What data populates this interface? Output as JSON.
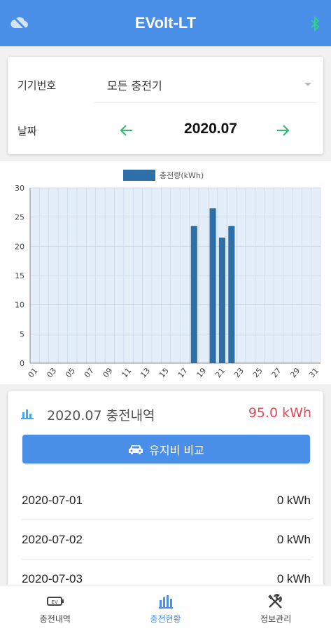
{
  "app": {
    "title": "EVolt-LT"
  },
  "filter": {
    "device_label": "기기번호",
    "device_value": "모든 충전기",
    "date_label": "날짜",
    "date_value": "2020.07"
  },
  "chart_data": {
    "type": "bar",
    "legend": [
      "충전량(kWh)"
    ],
    "series": [
      {
        "name": "충전량(kWh)",
        "color": "#2e6fa8",
        "values": [
          0,
          0,
          0,
          0,
          0,
          0,
          0,
          0,
          0,
          0,
          0,
          0,
          0,
          0,
          0,
          0,
          0,
          23.5,
          0,
          26.5,
          21.5,
          23.5,
          0,
          0,
          0,
          0,
          0,
          0,
          0,
          0,
          0
        ]
      }
    ],
    "categories": [
      "01",
      "02",
      "03",
      "04",
      "05",
      "06",
      "07",
      "08",
      "09",
      "10",
      "11",
      "12",
      "13",
      "14",
      "15",
      "16",
      "17",
      "18",
      "19",
      "20",
      "21",
      "22",
      "23",
      "24",
      "25",
      "26",
      "27",
      "28",
      "29",
      "30",
      "31"
    ],
    "xtick_labels": [
      "01",
      "03",
      "05",
      "07",
      "09",
      "11",
      "13",
      "15",
      "17",
      "19",
      "21",
      "23",
      "25",
      "27",
      "29",
      "31"
    ],
    "ylim": [
      0,
      30
    ],
    "yticks": [
      "0",
      "5",
      "10",
      "15",
      "20",
      "25",
      "30"
    ],
    "grid": true
  },
  "history": {
    "title": "2020.07 충전내역",
    "total": "95.0 kWh",
    "compare_button": "유지비 비교",
    "rows": [
      {
        "date": "2020-07-01",
        "value": "0 kWh"
      },
      {
        "date": "2020-07-02",
        "value": "0 kWh"
      },
      {
        "date": "2020-07-03",
        "value": "0 kWh"
      }
    ]
  },
  "nav": {
    "items": [
      {
        "label": "충전내역"
      },
      {
        "label": "충전현황"
      },
      {
        "label": "정보관리"
      }
    ]
  },
  "colors": {
    "primary": "#4a8fe7",
    "bar": "#2e6fa8",
    "total": "#e14b55",
    "arrow": "#3cb878"
  }
}
